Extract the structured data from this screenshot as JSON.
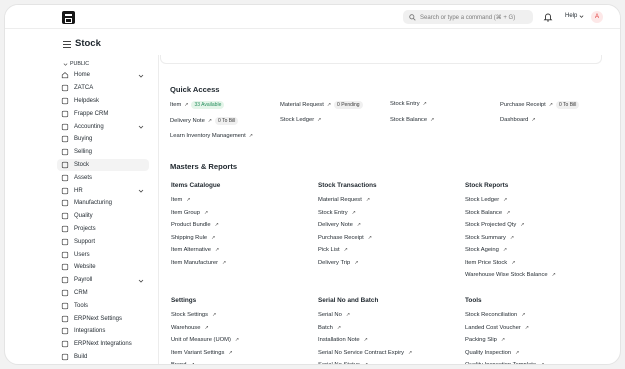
{
  "navbar": {
    "search_placeholder": "Search or type a command (⌘ + G)",
    "help_label": "Help",
    "avatar_initial": "A"
  },
  "page": {
    "title": "Stock"
  },
  "sidebar": {
    "section": "PUBLIC",
    "items": [
      {
        "label": "Home",
        "icon": "home-icon",
        "chevron": true
      },
      {
        "label": "ZATCA",
        "icon": "zatca-icon",
        "chevron": false
      },
      {
        "label": "Helpdesk",
        "icon": "helpdesk-icon",
        "chevron": false
      },
      {
        "label": "Frappe CRM",
        "icon": "crm-icon",
        "chevron": false
      },
      {
        "label": "Accounting",
        "icon": "accounting-icon",
        "chevron": true
      },
      {
        "label": "Buying",
        "icon": "buying-icon",
        "chevron": false
      },
      {
        "label": "Selling",
        "icon": "selling-icon",
        "chevron": false
      },
      {
        "label": "Stock",
        "icon": "stock-icon",
        "chevron": false,
        "active": true
      },
      {
        "label": "Assets",
        "icon": "assets-icon",
        "chevron": false
      },
      {
        "label": "HR",
        "icon": "hr-icon",
        "chevron": true
      },
      {
        "label": "Manufacturing",
        "icon": "manufacturing-icon",
        "chevron": false
      },
      {
        "label": "Quality",
        "icon": "quality-icon",
        "chevron": false
      },
      {
        "label": "Projects",
        "icon": "projects-icon",
        "chevron": false
      },
      {
        "label": "Support",
        "icon": "support-icon",
        "chevron": false
      },
      {
        "label": "Users",
        "icon": "users-icon",
        "chevron": false
      },
      {
        "label": "Website",
        "icon": "website-icon",
        "chevron": false
      },
      {
        "label": "Payroll",
        "icon": "payroll-icon",
        "chevron": true
      },
      {
        "label": "CRM",
        "icon": "crm2-icon",
        "chevron": false
      },
      {
        "label": "Tools",
        "icon": "tools-icon",
        "chevron": false
      },
      {
        "label": "ERPNext Settings",
        "icon": "settings-icon",
        "chevron": false
      },
      {
        "label": "Integrations",
        "icon": "integrations-icon",
        "chevron": false
      },
      {
        "label": "ERPNext Integrations",
        "icon": "integrations2-icon",
        "chevron": false
      },
      {
        "label": "Build",
        "icon": "build-icon",
        "chevron": false
      }
    ]
  },
  "quick_access": {
    "heading": "Quick Access",
    "item": {
      "label": "Item",
      "badge": "33 Available"
    },
    "material_request": {
      "label": "Material Request",
      "badge": "0 Pending"
    },
    "stock_entry": {
      "label": "Stock Entry"
    },
    "purchase_receipt": {
      "label": "Purchase Receipt",
      "badge": "0 To Bill"
    },
    "delivery_note": {
      "label": "Delivery Note",
      "badge": "0 To Bill"
    },
    "stock_ledger": {
      "label": "Stock Ledger"
    },
    "stock_balance": {
      "label": "Stock Balance"
    },
    "dashboard": {
      "label": "Dashboard"
    },
    "learn": {
      "label": "Learn Inventory Management"
    }
  },
  "masters": {
    "heading": "Masters & Reports",
    "items_catalogue": {
      "title": "Items Catalogue",
      "links": [
        "Item",
        "Item Group",
        "Product Bundle",
        "Shipping Rule",
        "Item Alternative",
        "Item Manufacturer"
      ]
    },
    "stock_transactions": {
      "title": "Stock Transactions",
      "links": [
        "Material Request",
        "Stock Entry",
        "Delivery Note",
        "Purchase Receipt",
        "Pick List",
        "Delivery Trip"
      ]
    },
    "stock_reports": {
      "title": "Stock Reports",
      "links": [
        "Stock Ledger",
        "Stock Balance",
        "Stock Projected Qty",
        "Stock Summary",
        "Stock Ageing",
        "Item Price Stock",
        "Warehouse Wise Stock Balance"
      ]
    },
    "settings": {
      "title": "Settings",
      "links": [
        "Stock Settings",
        "Warehouse",
        "Unit of Measure (UOM)",
        "Item Variant Settings",
        "Brand"
      ]
    },
    "serial_batch": {
      "title": "Serial No and Batch",
      "links": [
        "Serial No",
        "Batch",
        "Installation Note",
        "Serial No Service Contract Expiry",
        "Serial No Status"
      ]
    },
    "tools": {
      "title": "Tools",
      "links": [
        "Stock Reconciliation",
        "Landed Cost Voucher",
        "Packing Slip",
        "Quality Inspection",
        "Quality Inspection Template"
      ]
    }
  }
}
